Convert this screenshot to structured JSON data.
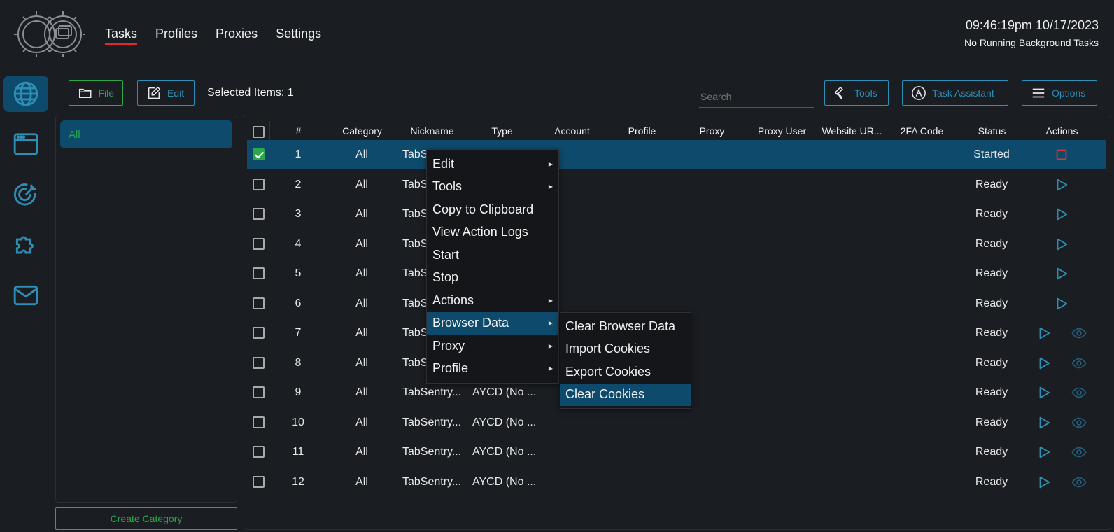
{
  "header": {
    "nav": [
      "Tasks",
      "Profiles",
      "Proxies",
      "Settings"
    ],
    "active_nav": "Tasks",
    "clock": "09:46:19pm 10/17/2023",
    "background_status": "No Running Background Tasks"
  },
  "rail": [
    "globe-icon",
    "browser-window-icon",
    "target-icon",
    "puzzle-icon",
    "mail-icon"
  ],
  "toolbar": {
    "file_label": "File",
    "edit_label": "Edit",
    "selected_items": "Selected Items: 1",
    "search_placeholder": "Search",
    "tools_label": "Tools",
    "assistant_label": "Task Assistant",
    "options_label": "Options"
  },
  "categories": {
    "items": [
      "All"
    ],
    "create_label": "Create Category"
  },
  "table": {
    "columns": [
      "#",
      "Category",
      "Nickname",
      "Type",
      "Account",
      "Profile",
      "Proxy",
      "Proxy User",
      "Website UR...",
      "2FA Code",
      "Status",
      "Actions"
    ],
    "rows": [
      {
        "num": "1",
        "category": "All",
        "nickname": "TabSe",
        "type": "",
        "status": "Started",
        "selected": true,
        "actions": "stop"
      },
      {
        "num": "2",
        "category": "All",
        "nickname": "TabSe",
        "type": "",
        "status": "Ready",
        "selected": false,
        "actions": "play"
      },
      {
        "num": "3",
        "category": "All",
        "nickname": "TabSe",
        "type": "",
        "status": "Ready",
        "selected": false,
        "actions": "play"
      },
      {
        "num": "4",
        "category": "All",
        "nickname": "TabSe",
        "type": "",
        "status": "Ready",
        "selected": false,
        "actions": "play"
      },
      {
        "num": "5",
        "category": "All",
        "nickname": "TabSe",
        "type": "",
        "status": "Ready",
        "selected": false,
        "actions": "play"
      },
      {
        "num": "6",
        "category": "All",
        "nickname": "TabSe",
        "type": "",
        "status": "Ready",
        "selected": false,
        "actions": "play"
      },
      {
        "num": "7",
        "category": "All",
        "nickname": "TabSe",
        "type": "",
        "status": "Ready",
        "selected": false,
        "actions": "play-view"
      },
      {
        "num": "8",
        "category": "All",
        "nickname": "TabSe",
        "type": "",
        "status": "Ready",
        "selected": false,
        "actions": "play-view"
      },
      {
        "num": "9",
        "category": "All",
        "nickname": "TabSentry...",
        "type": "AYCD (No ...",
        "status": "Ready",
        "selected": false,
        "actions": "play-view"
      },
      {
        "num": "10",
        "category": "All",
        "nickname": "TabSentry...",
        "type": "AYCD (No ...",
        "status": "Ready",
        "selected": false,
        "actions": "play-view"
      },
      {
        "num": "11",
        "category": "All",
        "nickname": "TabSentry...",
        "type": "AYCD (No ...",
        "status": "Ready",
        "selected": false,
        "actions": "play-view"
      },
      {
        "num": "12",
        "category": "All",
        "nickname": "TabSentry...",
        "type": "AYCD (No ...",
        "status": "Ready",
        "selected": false,
        "actions": "play-view"
      }
    ]
  },
  "context_menu": {
    "items": [
      {
        "label": "Edit",
        "submenu": true
      },
      {
        "label": "Tools",
        "submenu": true
      },
      {
        "label": "Copy to Clipboard",
        "submenu": false
      },
      {
        "label": "View Action Logs",
        "submenu": false
      },
      {
        "label": "Start",
        "submenu": false
      },
      {
        "label": "Stop",
        "submenu": false
      },
      {
        "label": "Actions",
        "submenu": true
      },
      {
        "label": "Browser Data",
        "submenu": true,
        "highlighted": true
      },
      {
        "label": "Proxy",
        "submenu": true
      },
      {
        "label": "Profile",
        "submenu": true
      }
    ],
    "submenu": [
      {
        "label": "Clear Browser Data"
      },
      {
        "label": "Import Cookies"
      },
      {
        "label": "Export Cookies"
      },
      {
        "label": "Clear Cookies",
        "highlighted": true
      }
    ]
  },
  "colors": {
    "background": "#1a1d22",
    "accent_blue": "#2d8fb6",
    "accent_green": "#2aa84a",
    "selection": "#0e4a6b",
    "nav_underline": "#e0272b",
    "stop_red": "#d9343d"
  }
}
